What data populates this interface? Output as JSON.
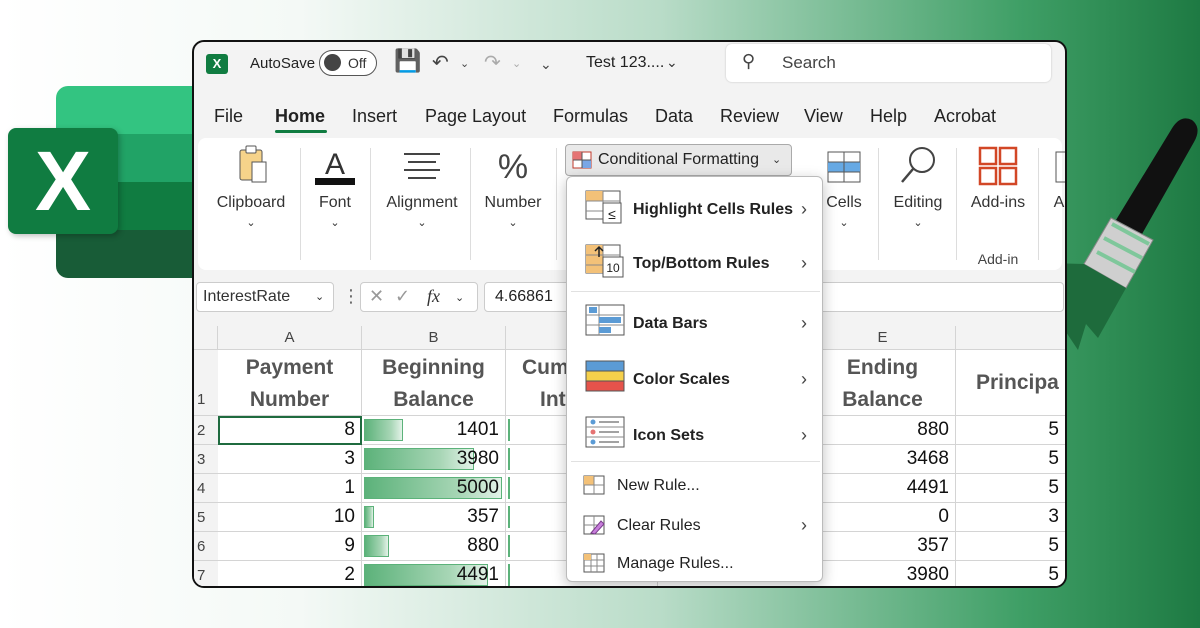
{
  "titlebar": {
    "app_icon": "X",
    "autosave_label": "AutoSave",
    "autosave_state": "Off",
    "file_name": "Test 123....",
    "search_placeholder": "Search"
  },
  "menubar": {
    "items": [
      "File",
      "Home",
      "Insert",
      "Page Layout",
      "Formulas",
      "Data",
      "Review",
      "View",
      "Help",
      "Acrobat"
    ],
    "active": "Home"
  },
  "ribbon": {
    "groups": [
      {
        "label": "Clipboard",
        "icon": "clipboard-icon"
      },
      {
        "label": "Font",
        "icon": "font-icon"
      },
      {
        "label": "Alignment",
        "icon": "alignment-icon"
      },
      {
        "label": "Number",
        "icon": "percent-icon"
      },
      {
        "label": "Cells",
        "icon": "cells-icon"
      },
      {
        "label": "Editing",
        "icon": "search-icon"
      },
      {
        "label": "Add-ins",
        "icon": "addins-icon"
      },
      {
        "label": "A",
        "icon": "acrobat-icon"
      }
    ],
    "addins_group_name": "Add-in",
    "conditional_formatting": "Conditional Formatting"
  },
  "formula_bar": {
    "name_box": "InterestRate",
    "fx": "fx",
    "value": "4.66861"
  },
  "grid": {
    "column_letters": [
      "A",
      "B",
      "E"
    ],
    "headers": {
      "A": [
        "Payment",
        "Number"
      ],
      "B": [
        "Beginning",
        "Balance"
      ],
      "C": [
        "Cum",
        "Int"
      ],
      "E": [
        "Ending",
        "Balance"
      ],
      "F": [
        "Principa"
      ]
    },
    "row_numbers": [
      "1",
      "2",
      "3",
      "4",
      "5",
      "6",
      "7"
    ],
    "rows": [
      {
        "payment": "8",
        "beginning": "1401",
        "beginning_pct": 0.28,
        "ending": "880",
        "principal": "5"
      },
      {
        "payment": "3",
        "beginning": "3980",
        "beginning_pct": 0.8,
        "ending": "3468",
        "principal": "5"
      },
      {
        "payment": "1",
        "beginning": "5000",
        "beginning_pct": 1.0,
        "ending": "4491",
        "principal": "5"
      },
      {
        "payment": "10",
        "beginning": "357",
        "beginning_pct": 0.07,
        "ending": "0",
        "principal": "3"
      },
      {
        "payment": "9",
        "beginning": "880",
        "beginning_pct": 0.18,
        "ending": "357",
        "principal": "5"
      },
      {
        "payment": "2",
        "beginning": "4491",
        "beginning_pct": 0.9,
        "ending": "3980",
        "principal": "5"
      }
    ]
  },
  "cf_menu": {
    "items": [
      {
        "label": "Highlight Cells Rules",
        "icon": "highlight-cells-icon",
        "submenu": true
      },
      {
        "label": "Top/Bottom Rules",
        "icon": "top-bottom-icon",
        "submenu": true
      },
      {
        "label": "Data Bars",
        "icon": "data-bars-icon",
        "submenu": true
      },
      {
        "label": "Color Scales",
        "icon": "color-scales-icon",
        "submenu": true
      },
      {
        "label": "Icon Sets",
        "icon": "icon-sets-icon",
        "submenu": true
      },
      {
        "label": "New Rule...",
        "icon": "new-rule-icon",
        "submenu": false
      },
      {
        "label": "Clear Rules",
        "icon": "clear-rules-icon",
        "submenu": true
      },
      {
        "label": "Manage Rules...",
        "icon": "manage-rules-icon",
        "submenu": false
      }
    ],
    "highlight_icon_text": "≤",
    "topbottom_icon_text": "10"
  },
  "colors": {
    "excel_green": "#107c41",
    "data_bar": "#5cb27a",
    "brush_handle": "#111111",
    "brush_bristles": "#1e7a43"
  }
}
